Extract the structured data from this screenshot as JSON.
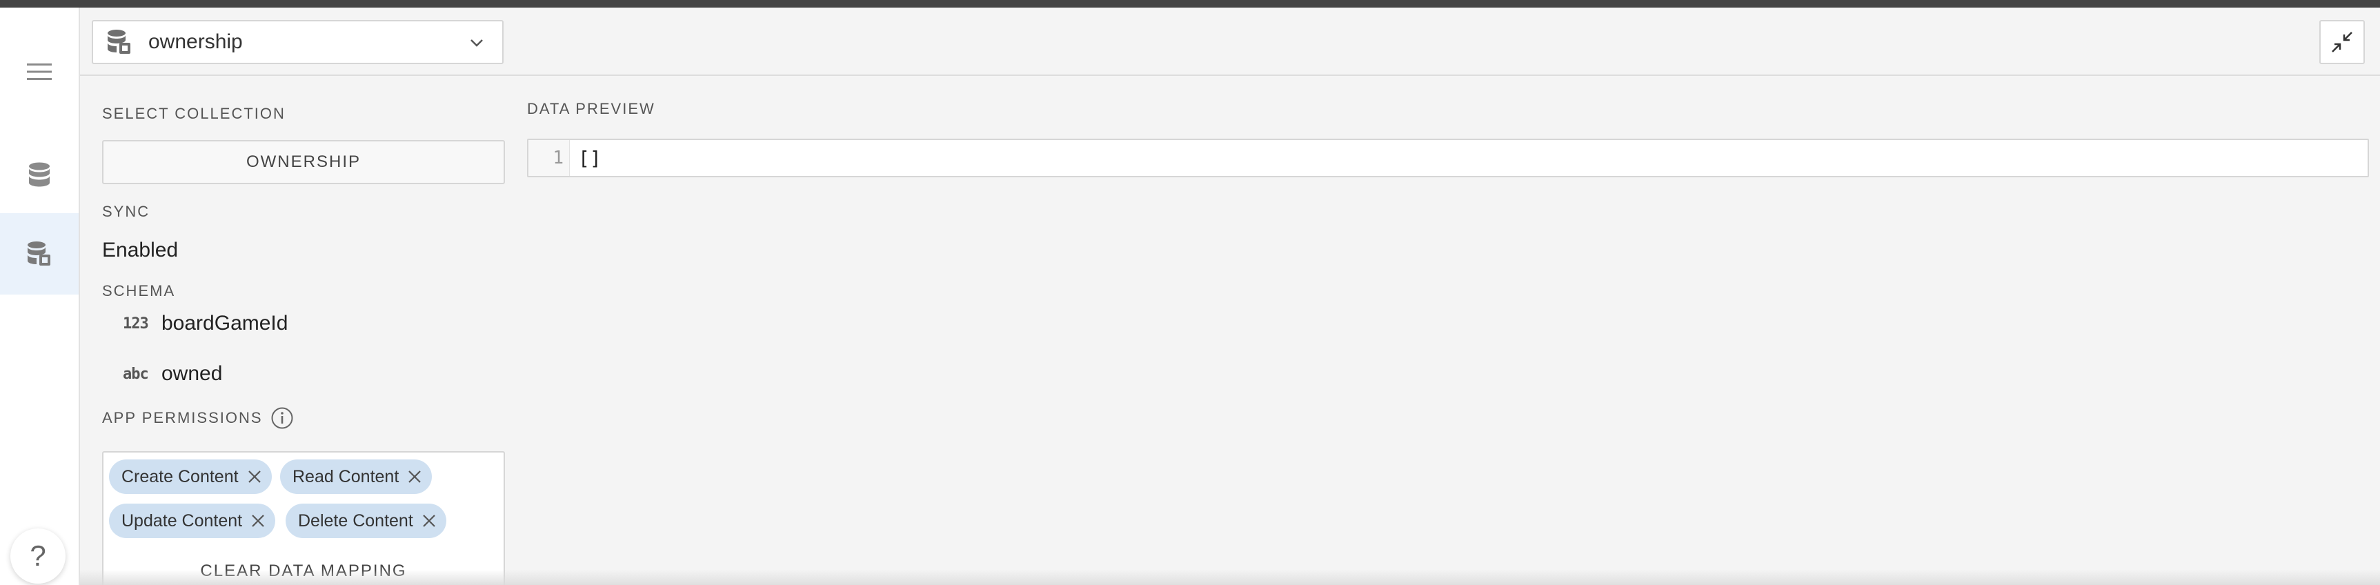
{
  "header": {
    "collection_selector": {
      "value": "ownership",
      "icon": "database-sync-icon"
    },
    "collapse_icon": "collapse-icon"
  },
  "rail": {
    "items": [
      {
        "icon": "menu-icon"
      },
      {
        "icon": "database-icon"
      },
      {
        "icon": "database-sync-icon",
        "active": true
      }
    ],
    "help_label": "?"
  },
  "select_collection": {
    "label": "SELECT COLLECTION",
    "button_label": "OWNERSHIP"
  },
  "sync": {
    "label": "SYNC",
    "value": "Enabled"
  },
  "schema": {
    "label": "SCHEMA",
    "fields": [
      {
        "type": "123",
        "name": "boardGameId"
      },
      {
        "type": "abc",
        "name": "owned"
      }
    ]
  },
  "app_permissions": {
    "label": "APP PERMISSIONS",
    "chips": [
      "Create Content",
      "Read Content",
      "Update Content",
      "Delete Content"
    ]
  },
  "clear_mapping_label": "CLEAR DATA MAPPING",
  "data_preview": {
    "label": "DATA PREVIEW",
    "line_number": "1",
    "code": "[]"
  },
  "colors": {
    "accent_chip": "#cfe0f1",
    "active_rail": "#eaf2fb",
    "top_strip": "#444444"
  }
}
